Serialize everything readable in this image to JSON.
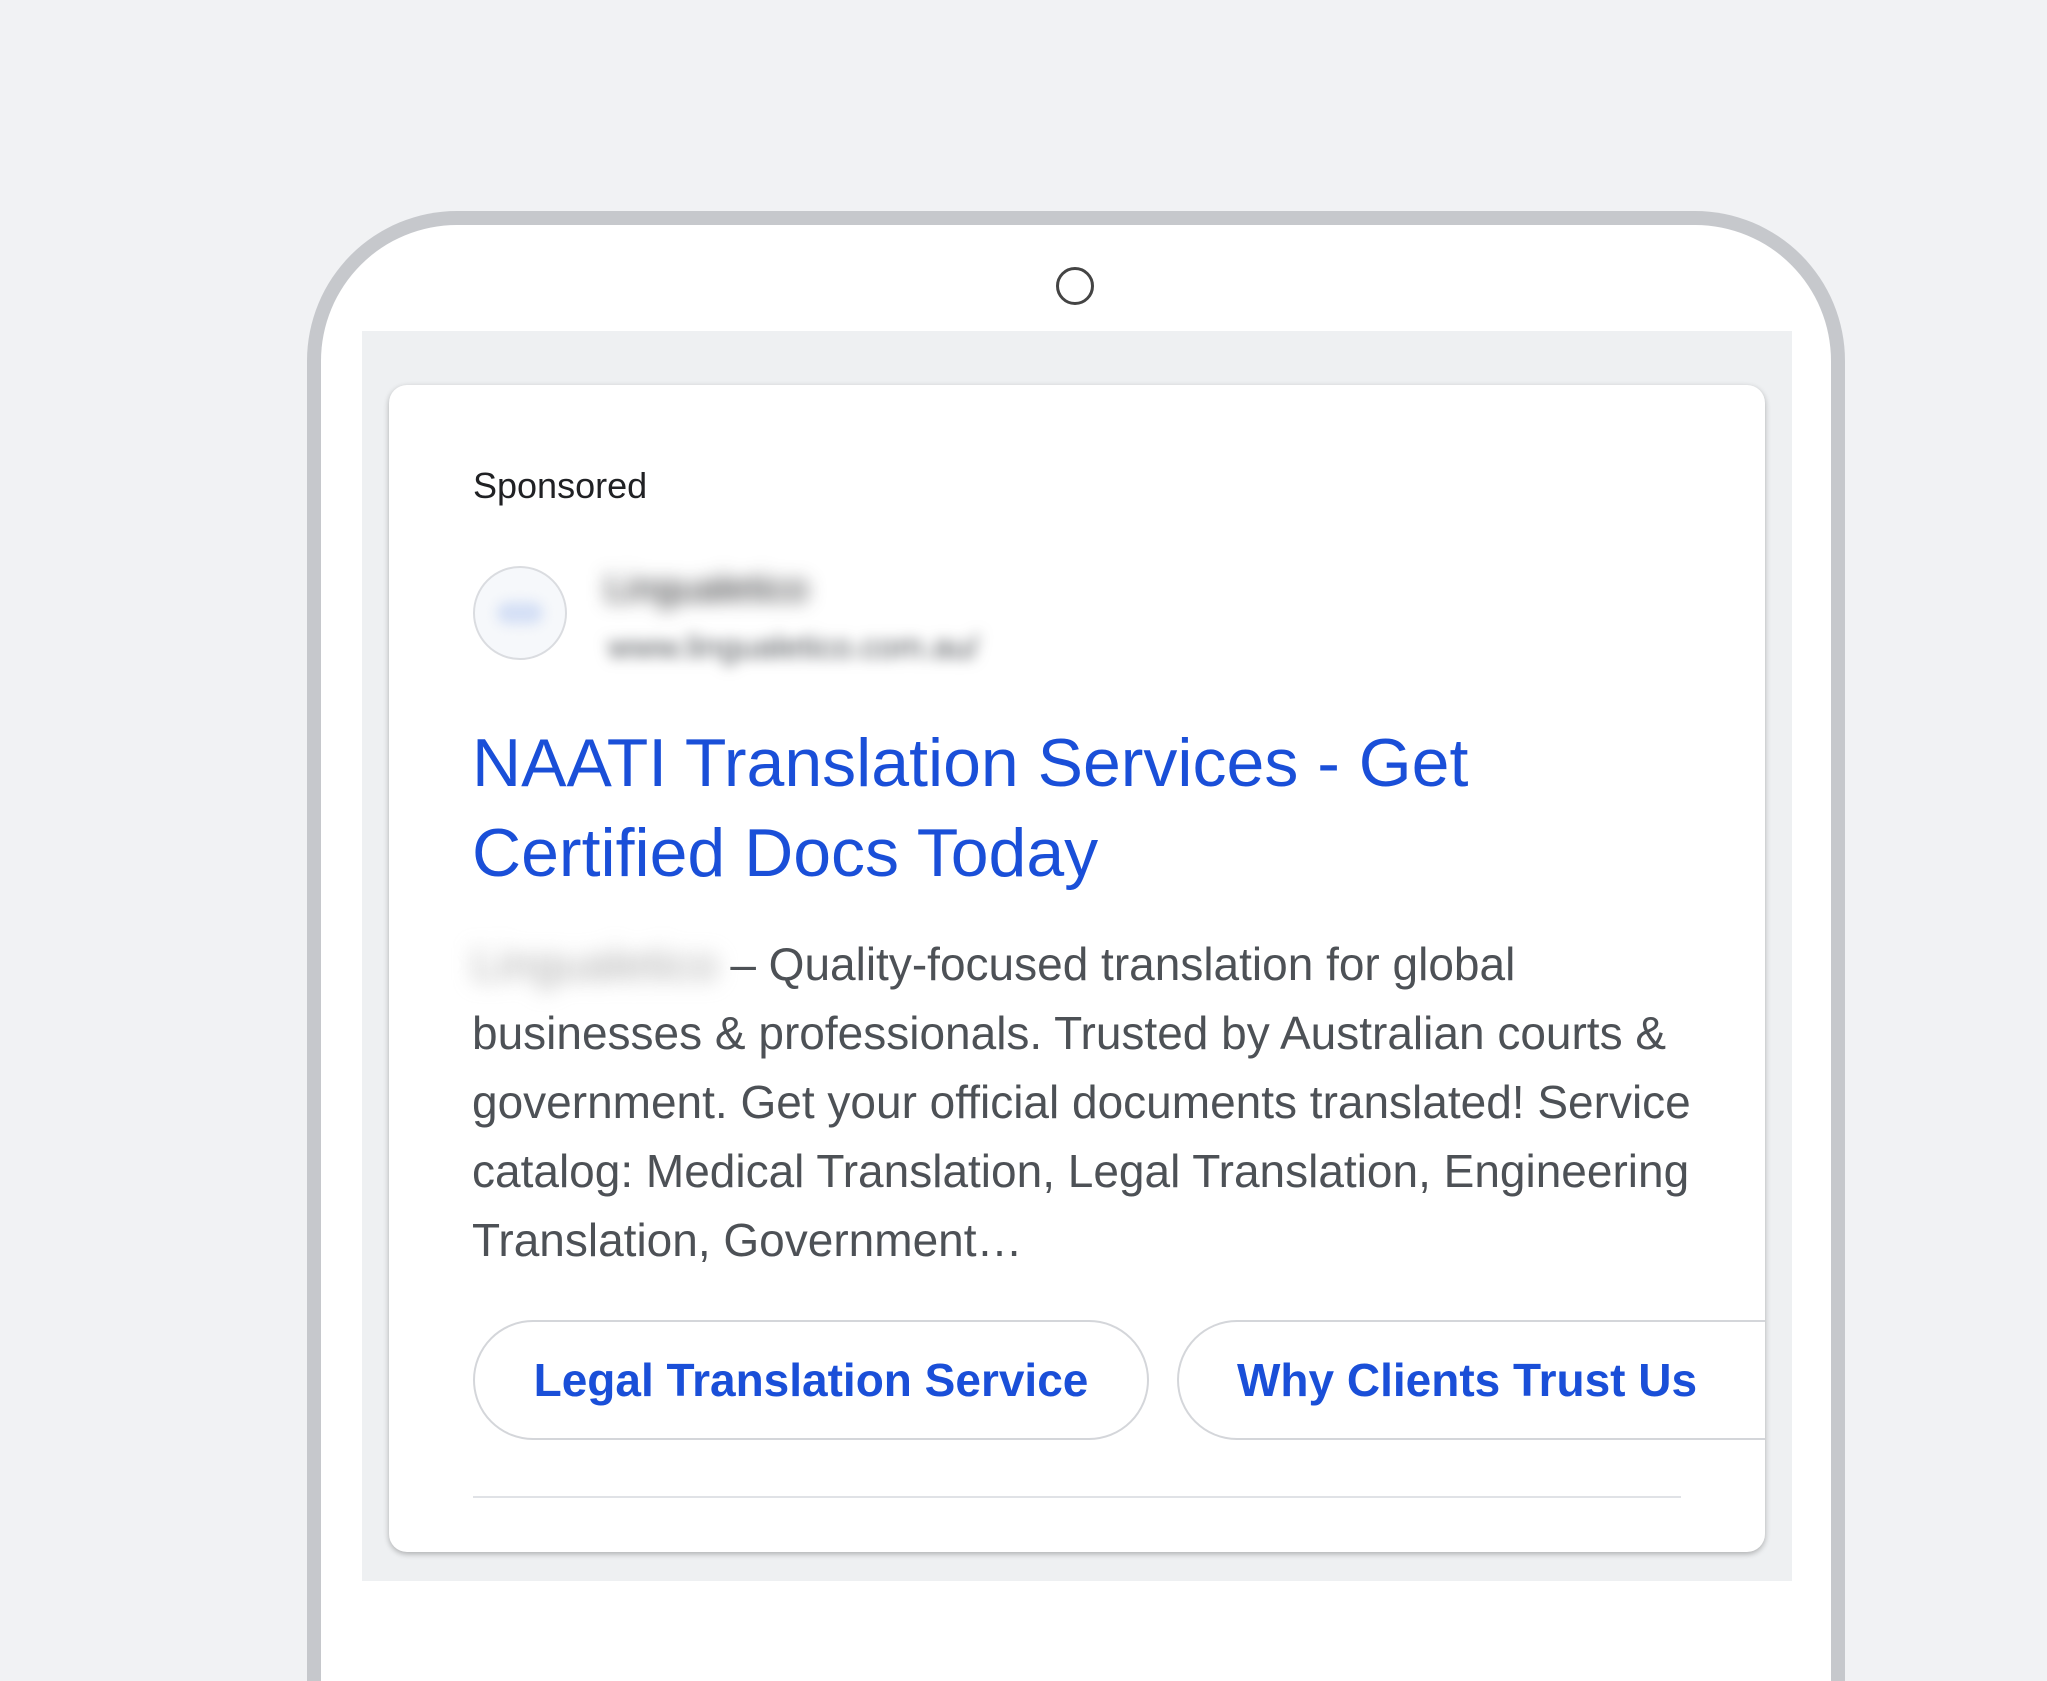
{
  "ad": {
    "sponsored_label": "Sponsored",
    "advertiser_name": "Lingualetico",
    "advertiser_url": "www.lingualetico.com.au/",
    "title": "NAATI Translation Services - Get Certified Docs Today",
    "description_name": "Lingualetico",
    "description": "– Quality-focused translation for global businesses & professionals. Trusted by Australian courts & government. Get your official documents translated! Service catalog: Medical Translation, Legal Translation, Engineering Translation, Government…",
    "sitelinks": [
      {
        "label": "Legal Translation Service"
      },
      {
        "label": "Why Clients Trust Us"
      }
    ]
  },
  "colors": {
    "link_blue": "#1a4fd8",
    "background": "#f1f2f4",
    "device_frame": "#c6c8cc"
  }
}
